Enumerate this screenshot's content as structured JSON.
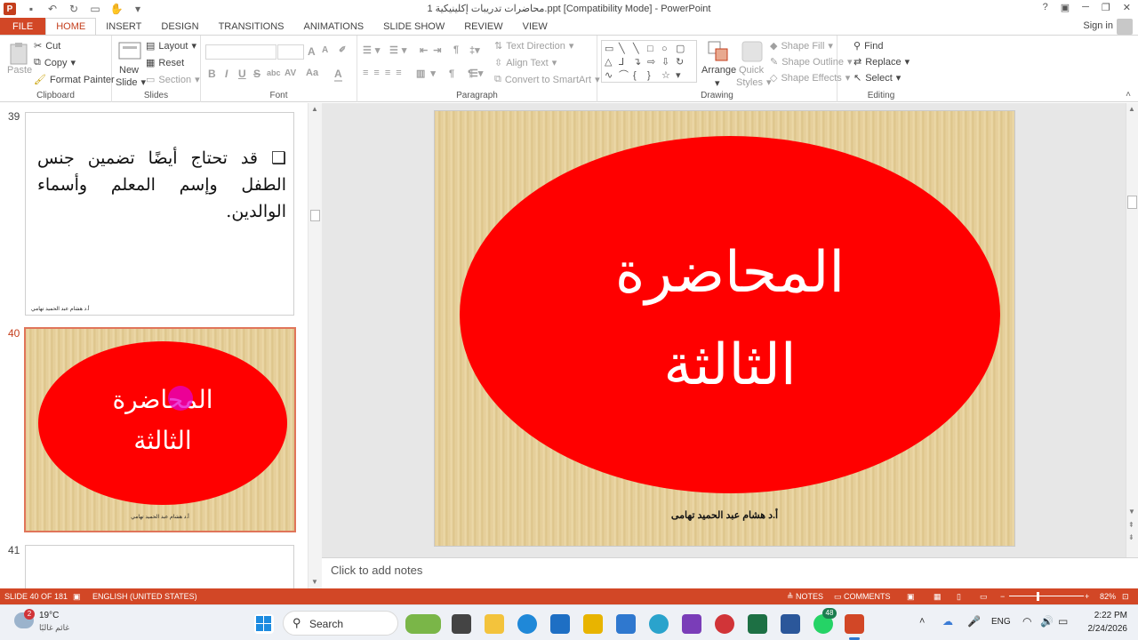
{
  "window": {
    "title": "محاضرات تدريبات إكلينيكية 1.ppt [Compatibility Mode] - PowerPoint",
    "controls": [
      "?",
      "▣",
      "─",
      "❐",
      "✕"
    ]
  },
  "tabs": [
    "FILE",
    "HOME",
    "INSERT",
    "DESIGN",
    "TRANSITIONS",
    "ANIMATIONS",
    "SLIDE SHOW",
    "REVIEW",
    "VIEW"
  ],
  "active_tab": "HOME",
  "sign_in": "Sign in",
  "ribbon": {
    "clipboard": {
      "label": "Clipboard",
      "paste": "Paste",
      "cut": "Cut",
      "copy": "Copy",
      "format_painter": "Format Painter"
    },
    "slides": {
      "label": "Slides",
      "new_slide": "New",
      "new_slide2": "Slide",
      "layout": "Layout",
      "reset": "Reset",
      "section": "Section"
    },
    "font": {
      "label": "Font",
      "bold": "B",
      "italic": "I",
      "underline": "U",
      "strike": "S",
      "shadow": "abc",
      "spacing": "AV",
      "case": "Aa",
      "color": "A",
      "grow": "A",
      "shrink": "A"
    },
    "paragraph": {
      "label": "Paragraph",
      "text_direction": "Text Direction",
      "align_text": "Align Text",
      "convert_smartart": "Convert to SmartArt"
    },
    "drawing": {
      "label": "Drawing",
      "arrange": "Arrange",
      "quick_styles": "Quick",
      "quick_styles2": "Styles",
      "shape_fill": "Shape Fill",
      "shape_outline": "Shape Outline",
      "shape_effects": "Shape Effects"
    },
    "editing": {
      "label": "Editing",
      "find": "Find",
      "replace": "Replace",
      "select": "Select"
    }
  },
  "thumbnails": [
    {
      "number": "39",
      "text": "❑ قد تحتاج أيضًا تضمين جنس الطفل وإسم المعلم وأسماء الوالدين.",
      "footer": "أ.د هشام عبد الحميد تهامي"
    },
    {
      "number": "40",
      "line1": "المحاضرة",
      "line2": "الثالثة",
      "footer": "أ.د هشام عبد الحميد تهامي",
      "selected": true
    },
    {
      "number": "41"
    }
  ],
  "slide": {
    "line1": "المحاضرة",
    "line2": "الثالثة",
    "footer": "أ.د هشام عبد الحميد تهامى",
    "ellipse_color": "#ff0000"
  },
  "notes_placeholder": "Click to add notes",
  "status": {
    "slide": "SLIDE 40 OF 181",
    "language": "ENGLISH (UNITED STATES)",
    "notes": "NOTES",
    "comments": "COMMENTS",
    "zoom": "82%"
  },
  "taskbar": {
    "weather_temp": "19°C",
    "weather_desc": "غائم غالبًا",
    "weather_badge": "2",
    "search": "Search",
    "whatsapp_badge": "48",
    "lang": "ENG",
    "time": "2:22 PM",
    "date": "2/24/2026"
  },
  "colors": {
    "accent": "#d24726",
    "red": "#ff0000"
  }
}
